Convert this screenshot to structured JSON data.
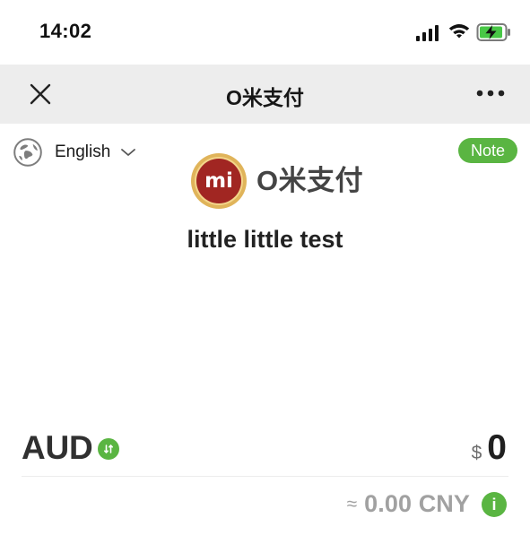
{
  "status_bar": {
    "time": "14:02",
    "signal_icon": "cellular-signal-icon",
    "wifi_icon": "wifi-icon",
    "battery_icon": "charging-battery-icon"
  },
  "navigation": {
    "title": "O米支付",
    "close_icon": "close-icon",
    "more_icon": "more-icon"
  },
  "language": {
    "selected": "English",
    "globe_icon": "globe-icon",
    "chevron_icon": "chevron-down-icon"
  },
  "note": {
    "label": "Note"
  },
  "merchant": {
    "logo_mark_text": "mi",
    "logo_brand_text": "O米支付",
    "name": "little little test"
  },
  "payment": {
    "currency": "AUD",
    "currency_toggle_icon": "switch-currency-icon",
    "currency_symbol": "$",
    "amount": "0",
    "approx_symbol": "≈",
    "converted_amount": "0.00 CNY",
    "info_icon": "info-icon",
    "info_label": "i"
  },
  "colors": {
    "accent_green": "#5ab542",
    "nav_background": "#ededed",
    "logo_red": "#a12622",
    "logo_gold": "#e0b45a",
    "muted_text": "#a1a1a1"
  }
}
